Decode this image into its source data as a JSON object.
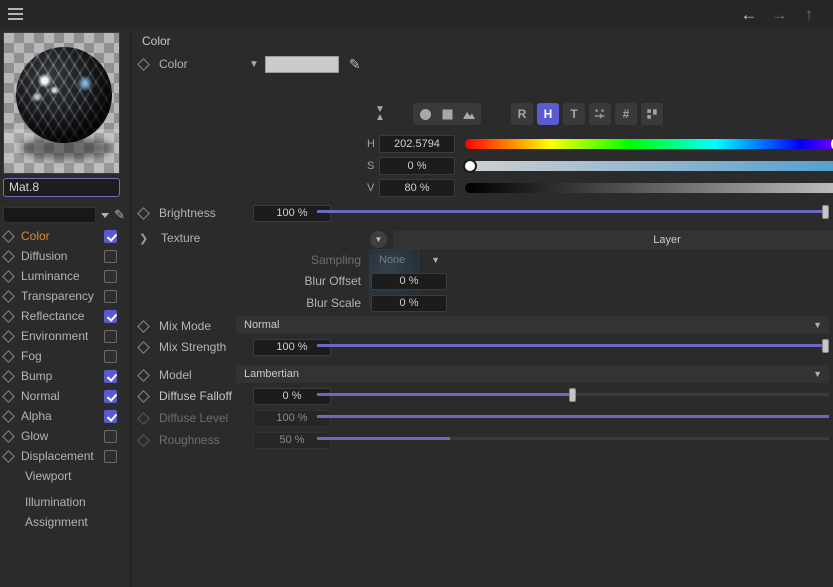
{
  "topbar": {
    "menu_icon": "hamburger-icon",
    "nav": [
      {
        "name": "back-arrow-icon",
        "glyph": "←",
        "state": "active"
      },
      {
        "name": "forward-arrow-icon",
        "glyph": "→",
        "state": "dim"
      },
      {
        "name": "up-arrow-icon",
        "glyph": "↑",
        "state": "dim"
      }
    ]
  },
  "sidebar": {
    "material_name": "Mat.8",
    "channels": [
      {
        "label": "Color",
        "checked": true,
        "selected": true
      },
      {
        "label": "Diffusion",
        "checked": false,
        "selected": false
      },
      {
        "label": "Luminance",
        "checked": false,
        "selected": false
      },
      {
        "label": "Transparency",
        "checked": false,
        "selected": false
      },
      {
        "label": "Reflectance",
        "checked": true,
        "selected": false
      },
      {
        "label": "Environment",
        "checked": false,
        "selected": false
      },
      {
        "label": "Fog",
        "checked": false,
        "selected": false
      },
      {
        "label": "Bump",
        "checked": true,
        "selected": false
      },
      {
        "label": "Normal",
        "checked": true,
        "selected": false
      },
      {
        "label": "Alpha",
        "checked": true,
        "selected": false
      },
      {
        "label": "Glow",
        "checked": false,
        "selected": false
      },
      {
        "label": "Displacement",
        "checked": false,
        "selected": false
      }
    ],
    "extra_items": [
      "Viewport"
    ],
    "bottom_items": [
      "Illumination",
      "Assignment"
    ]
  },
  "main": {
    "section_title": "Color",
    "color_row": {
      "label": "Color",
      "swatch_hex": "#cbcbcb",
      "eyedropper_icon": "eyedropper-icon"
    },
    "toolbar": {
      "collapse_icon": "collapse-expand-icon",
      "mode_icons": [
        "sphere-icon",
        "cube-icon",
        "image-icon"
      ],
      "buttons": [
        {
          "label": "R",
          "name": "rgb-mode-button",
          "active": false
        },
        {
          "label": "H",
          "name": "hsv-mode-button",
          "active": true
        },
        {
          "label": "T",
          "name": "temperature-mode-button",
          "active": false
        },
        {
          "label": "mixer-icon",
          "name": "mixer-mode-button",
          "active": false
        },
        {
          "label": "#",
          "name": "hex-mode-button",
          "active": false
        },
        {
          "label": "swatches-icon",
          "name": "swatches-mode-button",
          "active": false
        }
      ]
    },
    "hsv": [
      {
        "key": "H",
        "value": "202.5794",
        "pos_pct": 74.5
      },
      {
        "key": "S",
        "value": "0 %",
        "pos_pct": 0
      },
      {
        "key": "V",
        "value": "80 %",
        "pos_pct": 80
      }
    ],
    "brightness": {
      "label": "Brightness",
      "value": "100 %",
      "pos_pct": 100
    },
    "texture": {
      "label": "Texture",
      "layer_label": "Layer",
      "folder_icon": "folder-icon",
      "sampling": {
        "label": "Sampling",
        "value": "None"
      },
      "blur_offset": {
        "label": "Blur Offset",
        "value": "0 %"
      },
      "blur_scale": {
        "label": "Blur Scale",
        "value": "0 %"
      }
    },
    "mix_mode": {
      "label": "Mix Mode",
      "value": "Normal"
    },
    "mix_strength": {
      "label": "Mix Strength",
      "value": "100 %",
      "pos_pct": 100
    },
    "model": {
      "label": "Model",
      "value": "Lambertian"
    },
    "diffuse_falloff": {
      "label": "Diffuse Falloff",
      "value": "0 %",
      "pos_pct": 50,
      "enabled": true
    },
    "diffuse_level": {
      "label": "Diffuse Level",
      "value": "100 %",
      "pos_pct": 100,
      "enabled": false
    },
    "roughness": {
      "label": "Roughness",
      "value": "50 %",
      "pos_pct": 26,
      "enabled": false
    }
  },
  "colors": {
    "accent_purple": "#5b5bd0",
    "slider_fill": "#6a6ac4",
    "selected_label": "#d98a3a",
    "panel_bg": "#2b2b2b",
    "topbar_bg": "#262626"
  }
}
